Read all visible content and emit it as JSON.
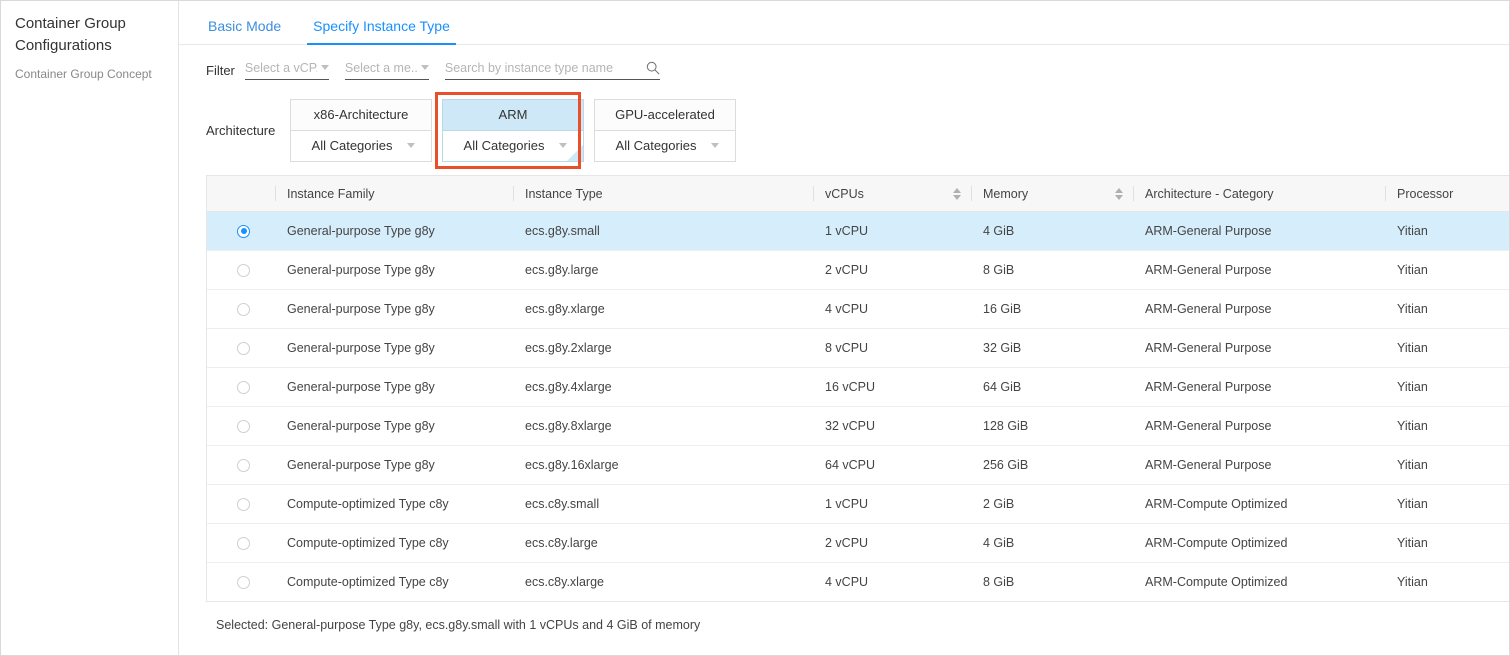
{
  "sidebar": {
    "title": "Container Group Configurations",
    "items": [
      {
        "label": "Container Group Concept"
      }
    ]
  },
  "tabs": [
    {
      "label": "Basic Mode",
      "active": false
    },
    {
      "label": "Specify Instance Type",
      "active": true
    }
  ],
  "filter": {
    "label": "Filter",
    "vcpu_select": {
      "placeholder": "Select a vCP...",
      "value": ""
    },
    "memory_select": {
      "placeholder": "Select a me...",
      "value": ""
    },
    "search": {
      "placeholder": "Search by instance type name",
      "value": "",
      "icon": "search-icon"
    }
  },
  "architecture": {
    "label": "Architecture",
    "cards": [
      {
        "name": "x86-Architecture",
        "category": "All Categories",
        "selected": false,
        "highlight": false
      },
      {
        "name": "ARM",
        "category": "All Categories",
        "selected": true,
        "highlight": true
      },
      {
        "name": "GPU-accelerated",
        "category": "All Categories",
        "selected": false,
        "highlight": false
      }
    ]
  },
  "table": {
    "columns": [
      {
        "key": "radio",
        "label": ""
      },
      {
        "key": "family",
        "label": "Instance Family",
        "sortable": false
      },
      {
        "key": "type",
        "label": "Instance Type",
        "sortable": false
      },
      {
        "key": "vcpus",
        "label": "vCPUs",
        "sortable": true
      },
      {
        "key": "memory",
        "label": "Memory",
        "sortable": true
      },
      {
        "key": "arch",
        "label": "Architecture - Category",
        "sortable": false
      },
      {
        "key": "processor",
        "label": "Processor",
        "sortable": false
      }
    ],
    "rows": [
      {
        "selected": true,
        "family": "General-purpose Type g8y",
        "type": "ecs.g8y.small",
        "vcpus": "1 vCPU",
        "memory": "4 GiB",
        "arch": "ARM-General Purpose",
        "processor": "Yitian"
      },
      {
        "selected": false,
        "family": "General-purpose Type g8y",
        "type": "ecs.g8y.large",
        "vcpus": "2 vCPU",
        "memory": "8 GiB",
        "arch": "ARM-General Purpose",
        "processor": "Yitian"
      },
      {
        "selected": false,
        "family": "General-purpose Type g8y",
        "type": "ecs.g8y.xlarge",
        "vcpus": "4 vCPU",
        "memory": "16 GiB",
        "arch": "ARM-General Purpose",
        "processor": "Yitian"
      },
      {
        "selected": false,
        "family": "General-purpose Type g8y",
        "type": "ecs.g8y.2xlarge",
        "vcpus": "8 vCPU",
        "memory": "32 GiB",
        "arch": "ARM-General Purpose",
        "processor": "Yitian"
      },
      {
        "selected": false,
        "family": "General-purpose Type g8y",
        "type": "ecs.g8y.4xlarge",
        "vcpus": "16 vCPU",
        "memory": "64 GiB",
        "arch": "ARM-General Purpose",
        "processor": "Yitian"
      },
      {
        "selected": false,
        "family": "General-purpose Type g8y",
        "type": "ecs.g8y.8xlarge",
        "vcpus": "32 vCPU",
        "memory": "128 GiB",
        "arch": "ARM-General Purpose",
        "processor": "Yitian"
      },
      {
        "selected": false,
        "family": "General-purpose Type g8y",
        "type": "ecs.g8y.16xlarge",
        "vcpus": "64 vCPU",
        "memory": "256 GiB",
        "arch": "ARM-General Purpose",
        "processor": "Yitian"
      },
      {
        "selected": false,
        "family": "Compute-optimized Type c8y",
        "type": "ecs.c8y.small",
        "vcpus": "1 vCPU",
        "memory": "2 GiB",
        "arch": "ARM-Compute Optimized",
        "processor": "Yitian"
      },
      {
        "selected": false,
        "family": "Compute-optimized Type c8y",
        "type": "ecs.c8y.large",
        "vcpus": "2 vCPU",
        "memory": "4 GiB",
        "arch": "ARM-Compute Optimized",
        "processor": "Yitian"
      },
      {
        "selected": false,
        "family": "Compute-optimized Type c8y",
        "type": "ecs.c8y.xlarge",
        "vcpus": "4 vCPU",
        "memory": "8 GiB",
        "arch": "ARM-Compute Optimized",
        "processor": "Yitian"
      }
    ]
  },
  "footer": {
    "selected_summary": "Selected: General-purpose Type g8y, ecs.g8y.small with 1 vCPUs and 4 GiB of memory"
  },
  "colors": {
    "accent": "#1890ff",
    "highlight_border": "#e8502b",
    "selected_row": "#d6eefb",
    "selected_card_header": "#cfe8f7"
  }
}
